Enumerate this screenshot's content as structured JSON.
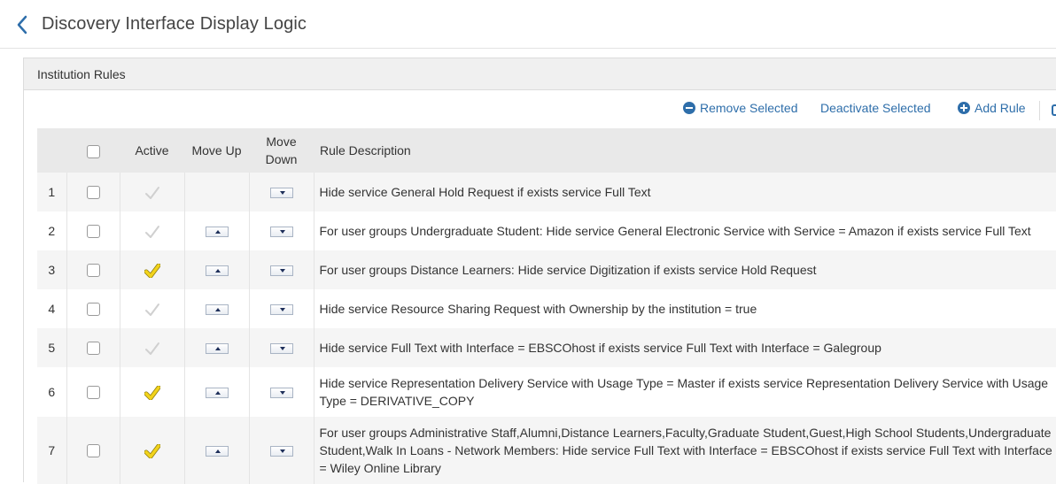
{
  "header": {
    "title": "Discovery Interface Display Logic"
  },
  "panel": {
    "title": "Institution Rules"
  },
  "toolbar": {
    "remove_label": "Remove Selected",
    "deactivate_label": "Deactivate Selected",
    "add_label": "Add Rule"
  },
  "table": {
    "columns": {
      "active": "Active",
      "move_up": "Move Up",
      "move_down_1": "Move",
      "move_down_2": "Down",
      "description": "Rule Description"
    },
    "rows": [
      {
        "num": "1",
        "active": false,
        "move_up": false,
        "move_down": true,
        "description": "Hide service General Hold Request if exists service Full Text"
      },
      {
        "num": "2",
        "active": false,
        "move_up": true,
        "move_down": true,
        "description": "For user groups Undergraduate Student: Hide service General Electronic Service with Service = Amazon if exists service Full Text"
      },
      {
        "num": "3",
        "active": true,
        "move_up": true,
        "move_down": true,
        "description": "For user groups Distance Learners: Hide service Digitization if exists service Hold Request"
      },
      {
        "num": "4",
        "active": false,
        "move_up": true,
        "move_down": true,
        "description": "Hide service Resource Sharing Request with Ownership by the institution = true"
      },
      {
        "num": "5",
        "active": false,
        "move_up": true,
        "move_down": true,
        "description": "Hide service Full Text with Interface = EBSCOhost if exists service Full Text with Interface = Galegroup"
      },
      {
        "num": "6",
        "active": true,
        "move_up": true,
        "move_down": true,
        "description": "Hide service Representation Delivery Service with Usage Type = Master if exists service Representation Delivery Service with Usage Type = DERIVATIVE_COPY"
      },
      {
        "num": "7",
        "active": true,
        "move_up": true,
        "move_down": true,
        "description": "For user groups Administrative Staff,Alumni,Distance Learners,Faculty,Graduate Student,Guest,High School Students,Undergraduate Student,Walk In Loans - Network Members: Hide service Full Text with Interface = EBSCOhost if exists service Full Text with Interface = Wiley Online Library"
      }
    ]
  },
  "colors": {
    "link": "#2e6eaa",
    "active_check": "#f2d31b",
    "inactive_check": "#d0d0d0"
  }
}
